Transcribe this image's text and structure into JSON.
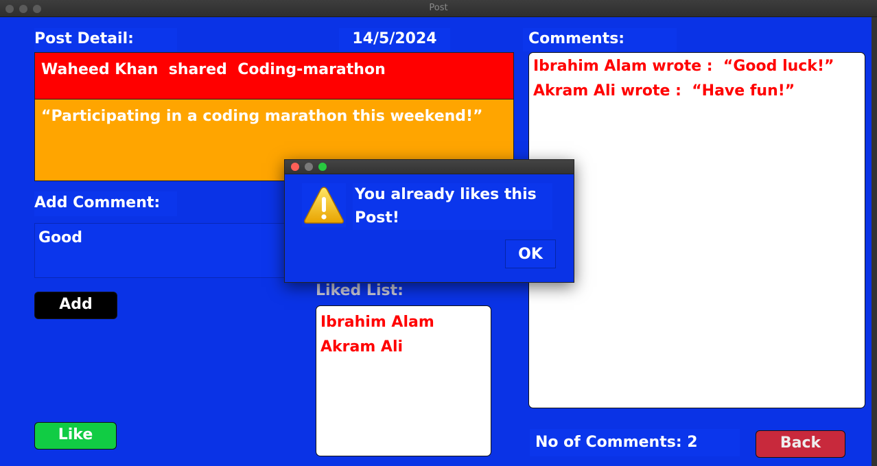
{
  "window": {
    "title": "Post"
  },
  "post": {
    "header_label": "Post Detail:",
    "date": "14/5/2024",
    "shared_line": "Waheed Khan  shared  Coding-marathon",
    "content": "“Participating in a coding marathon this weekend!”"
  },
  "add_comment": {
    "label": "Add Comment:",
    "value": "Good",
    "add_label": "Add"
  },
  "like": {
    "label": "Like"
  },
  "liked_list": {
    "label": "Liked List:",
    "items": [
      "Ibrahim Alam",
      "Akram Ali"
    ]
  },
  "comments": {
    "label": "Comments:",
    "items": [
      "Ibrahim Alam wrote :  “Good luck!”",
      "Akram Ali wrote :  “Have fun!”"
    ],
    "count_text": "No of Comments: 2"
  },
  "back": {
    "label": "Back"
  },
  "dialog": {
    "message": "You already likes this Post!",
    "ok_label": "OK"
  },
  "colors": {
    "background": "#0a33e6",
    "header_red": "#ff0000",
    "content_orange": "#ffa500",
    "like_green": "#11cc44",
    "back_red": "#c8293c"
  }
}
